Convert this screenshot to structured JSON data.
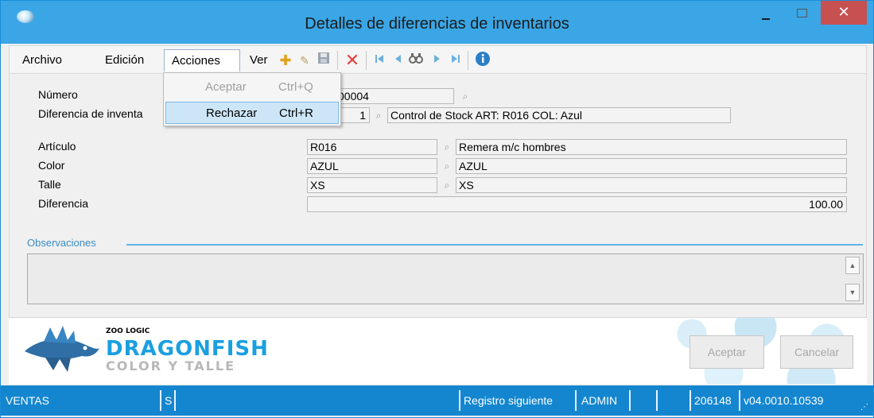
{
  "window": {
    "title": "Detalles de diferencias de inventarios",
    "close_glyph": "✕"
  },
  "menu": {
    "archivo": "Archivo",
    "edicion": "Edición",
    "acciones": "Acciones",
    "ver": "Ver",
    "acciones_items": [
      {
        "label": "Aceptar",
        "shortcut": "Ctrl+Q",
        "enabled": false
      },
      {
        "label": "Rechazar",
        "shortcut": "Ctrl+R",
        "enabled": true
      }
    ]
  },
  "toolbar": {
    "icons": [
      "add-icon",
      "edit-icon",
      "save-icon",
      "delete-icon",
      "first-icon",
      "prev-icon",
      "search-icon",
      "next-icon",
      "last-icon",
      "info-icon"
    ]
  },
  "form": {
    "numero": {
      "label": "Número",
      "value": "00004"
    },
    "diferencia_inventario": {
      "label": "Diferencia de inventa",
      "value": "1",
      "description": "Control de Stock ART: R016 COL: Azul"
    },
    "articulo": {
      "label": "Artículo",
      "code": "R016",
      "description": "Remera m/c hombres"
    },
    "color": {
      "label": "Color",
      "code": "AZUL",
      "description": "AZUL"
    },
    "talle": {
      "label": "Talle",
      "code": "XS",
      "description": "XS"
    },
    "diferencia": {
      "label": "Diferencia",
      "value": "100.00"
    },
    "observaciones": {
      "label": "Observaciones",
      "value": ""
    }
  },
  "footer": {
    "logo": {
      "brand": "ZOO LOGIC",
      "product": "DRAGONFISH",
      "subtitle": "COLOR Y TALLE"
    },
    "aceptar": "Aceptar",
    "cancelar": "Cancelar"
  },
  "status": {
    "module": "VENTAS",
    "flag": "S",
    "action": "Registro siguiente",
    "user": "ADMIN",
    "number": "206148",
    "version": "v04.0010.10539"
  },
  "colors": {
    "titlebar": "#3aa6e6",
    "statusbar": "#1486d0",
    "close": "#c75050",
    "accent": "#1a9fe0"
  }
}
